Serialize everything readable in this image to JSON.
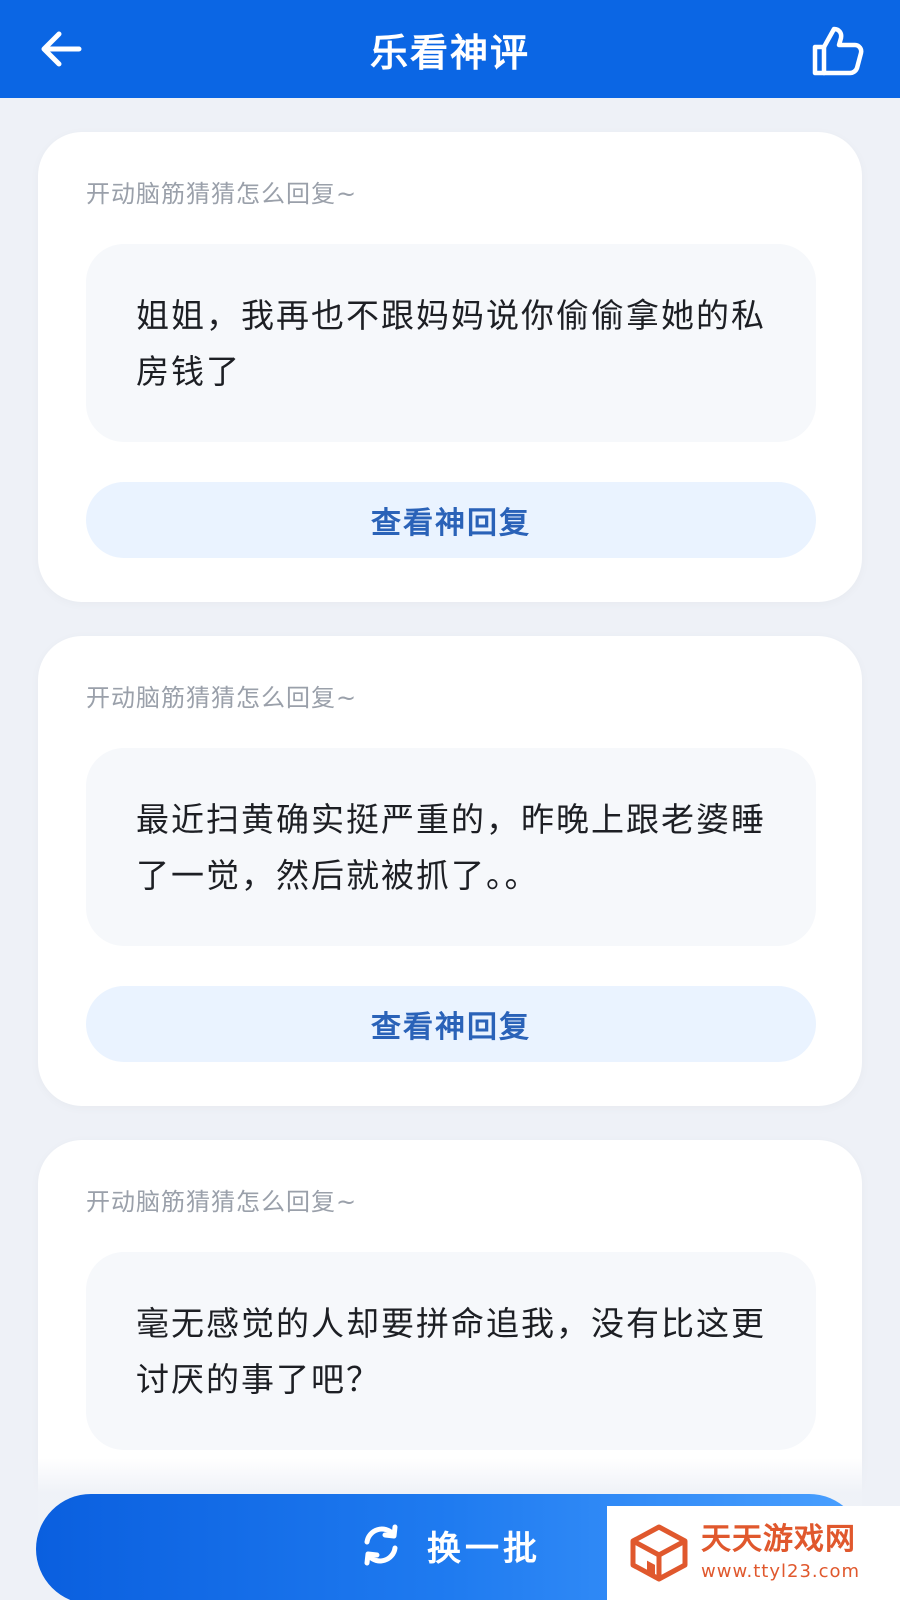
{
  "header": {
    "title": "乐看神评",
    "back_icon": "arrow-left-icon",
    "like_icon": "thumbs-up-icon"
  },
  "cards": [
    {
      "hint": "开动脑筋猜猜怎么回复~",
      "text": "姐姐，我再也不跟妈妈说你偷偷拿她的私房钱了",
      "button": "查看神回复"
    },
    {
      "hint": "开动脑筋猜猜怎么回复~",
      "text": "最近扫黄确实挺严重的，昨晚上跟老婆睡了一觉，然后就被抓了。。",
      "button": "查看神回复"
    },
    {
      "hint": "开动脑筋猜猜怎么回复~",
      "text": "毫无感觉的人却要拼命追我，没有比这更讨厌的事了吧？"
    }
  ],
  "bottom": {
    "refresh_label": "换一批",
    "refresh_icon": "refresh-icon"
  },
  "watermark": {
    "title": "天天游戏网",
    "url": "www.ttyl23.com"
  },
  "colors": {
    "header": "#0b66e4",
    "reply_text": "#2a62b8",
    "reply_bg": "#eaf3ff",
    "watermark": "#e0582d"
  }
}
